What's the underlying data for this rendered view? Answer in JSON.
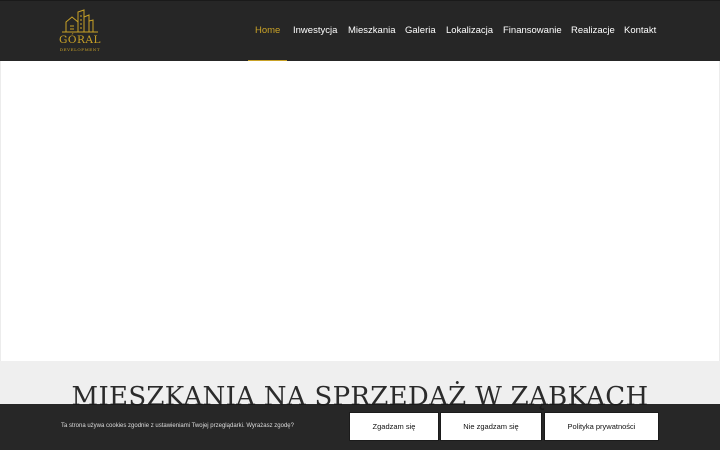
{
  "brand": {
    "name": "GÓRAL",
    "tagline": "DEVELOPMENT",
    "accent_color": "#c9a227"
  },
  "nav": {
    "items": [
      {
        "label": "Home",
        "active": true
      },
      {
        "label": "Inwestycja",
        "active": false
      },
      {
        "label": "Mieszkania",
        "active": false
      },
      {
        "label": "Galeria",
        "active": false
      },
      {
        "label": "Lokalizacja",
        "active": false
      },
      {
        "label": "Finansowanie",
        "active": false
      },
      {
        "label": "Realizacje",
        "active": false
      },
      {
        "label": "Kontakt",
        "active": false
      }
    ]
  },
  "main": {
    "section_title": "MIESZKANIA NA SPRZEDAŻ W ZĄBKACH"
  },
  "cookie": {
    "message": "Ta strona używa cookies zgodnie z ustawieniami Twojej przeglądarki. Wyrażasz zgodę?",
    "agree_label": "Zgadzam się",
    "disagree_label": "Nie zgadzam się",
    "policy_label": "Polityka prywatności"
  }
}
